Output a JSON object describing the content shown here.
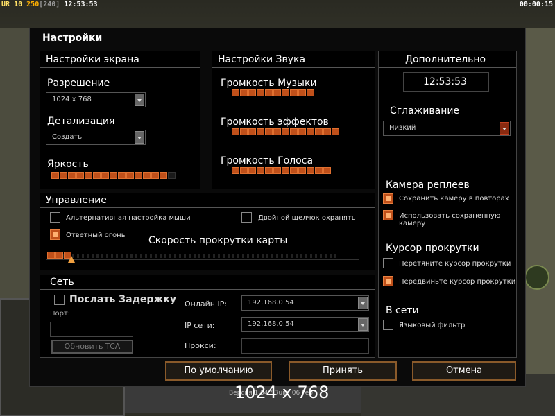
{
  "hud": {
    "ur": "UR",
    "n1": "10",
    "n2": "250",
    "n3": "[240]",
    "clock": "12:53:53",
    "timer": "00:00:15"
  },
  "dialog": {
    "title": "Настройки",
    "screen": {
      "title": "Настройки экрана",
      "resolution_label": "Разрешение",
      "resolution_value": "1024 x 768",
      "detail_label": "Детализация",
      "detail_value": "Создать",
      "brightness_label": "Яркость",
      "brightness_level": 14
    },
    "sound": {
      "title": "Настройки Звука",
      "music_label": "Громкость Музыки",
      "music_level": 10,
      "effects_label": "Громкость эффектов",
      "effects_level": 13,
      "voice_label": "Громкость Голоса",
      "voice_level": 12
    },
    "extra": {
      "title": "Дополнительно",
      "time": "12:53:53",
      "aa_label": "Сглаживание",
      "aa_value": "Низкий",
      "replay_cam_label": "Камера реплеев",
      "save_cam": "Сохранить камеру в повторах",
      "use_saved_cam": "Использовать сохраненную камеру",
      "scroll_cursor_label": "Курсор прокрутки",
      "drag_cursor": "Перетяните курсор прокрутки",
      "move_cursor": "Передвиньте курсор прокрутки",
      "online_label": "В сети",
      "lang_filter": "Языковый фильтр"
    },
    "control": {
      "title": "Управление",
      "alt_mouse": "Альтернативная настройка мыши",
      "double_click": "Двойной щелчок охранять",
      "return_fire": "Ответный огонь",
      "scroll_speed_label": "Скорость прокрутки карты",
      "scroll_speed_level": 3
    },
    "network": {
      "title": "Сеть",
      "send_delay": "Послать Задержку",
      "port_label": "Порт:",
      "update_btn": "Обновить TCA",
      "online_ip_label": "Онлайн IP:",
      "online_ip_value": "192.168.0.54",
      "lan_ip_label": "IP сети:",
      "lan_ip_value": "192.168.0.54",
      "proxy_label": "Прокси:"
    },
    "buttons": {
      "default": "По умолчанию",
      "accept": "Принять",
      "cancel": "Отмена"
    }
  },
  "overlay": {
    "resolution": "1024 x 768",
    "version": "Версия 1.04 / Build 06 Feb"
  },
  "colors": {
    "accent": "#c0501a",
    "panel_bg": "#000000"
  }
}
